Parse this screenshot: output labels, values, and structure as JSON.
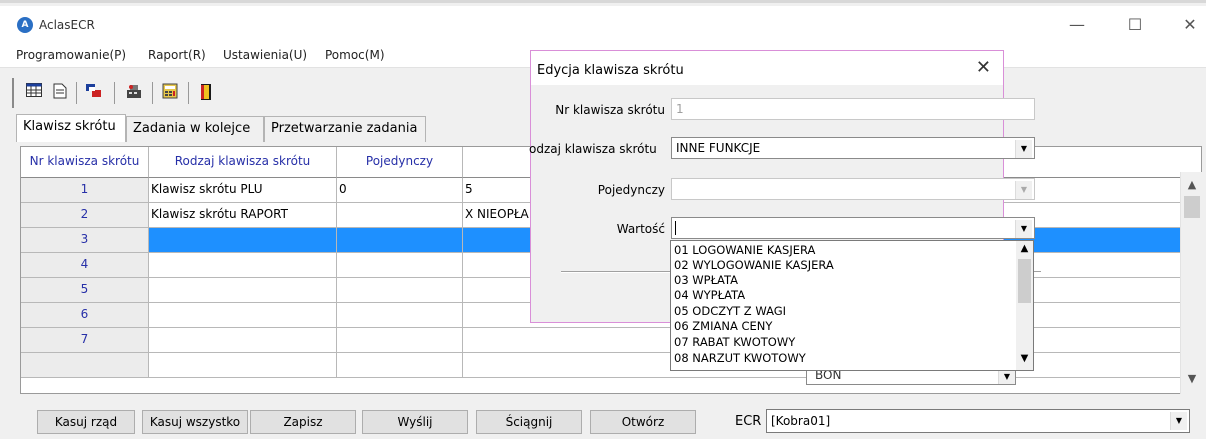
{
  "window": {
    "title": "AclasECR",
    "minimize": "—",
    "maximize": "☐",
    "close": "✕"
  },
  "menu": [
    "Programowanie(P)",
    "Raport(R)",
    "Ustawienia(U)",
    "Pomoc(M)"
  ],
  "toolbar": {
    "icons": [
      "table-icon",
      "document-icon",
      "transfer-icon",
      "cash-register-icon",
      "calculator-icon",
      "exit-door-icon"
    ]
  },
  "tabs": [
    "Klawisz skrótu",
    "Zadania w kolejce",
    "Przetwarzanie zadania"
  ],
  "grid": {
    "columns": [
      "Nr klawisza skrótu",
      "Rodzaj klawisza skrótu",
      "Pojedynczy",
      ""
    ],
    "rows": [
      {
        "nr": "1",
        "rodzaj": "Klawisz skrótu PLU",
        "pojedynczy": "0",
        "wartosc": "5"
      },
      {
        "nr": "2",
        "rodzaj": "Klawisz skrótu RAPORT",
        "pojedynczy": "",
        "wartosc": "X NIEOPŁA"
      },
      {
        "nr": "3",
        "rodzaj": "",
        "pojedynczy": "",
        "wartosc": ""
      },
      {
        "nr": "4",
        "rodzaj": "",
        "pojedynczy": "",
        "wartosc": ""
      },
      {
        "nr": "5",
        "rodzaj": "",
        "pojedynczy": "",
        "wartosc": ""
      },
      {
        "nr": "6",
        "rodzaj": "",
        "pojedynczy": "",
        "wartosc": ""
      },
      {
        "nr": "7",
        "rodzaj": "",
        "pojedynczy": "",
        "wartosc": ""
      }
    ],
    "selected_row": 3
  },
  "buttons": {
    "kasuj_rzad": "Kasuj rząd",
    "kasuj_wszystko": "Kasuj wszystko",
    "zapisz": "Zapisz",
    "wyslij": "Wyślij",
    "sciagnij": "Ściągnij",
    "otworz": "Otwórz"
  },
  "ecr": {
    "label": "ECR",
    "value": "[Kobra01]"
  },
  "partial_combo": "BON",
  "dialog": {
    "title": "Edycja klawisza skrótu",
    "close": "✕",
    "fields": {
      "nr_label": "Nr klawisza skrótu",
      "nr_value": "1",
      "rodzaj_label": "odzaj klawisza skrótu",
      "rodzaj_value": "INNE FUNKCJE",
      "pojedynczy_label": "Pojedynczy",
      "pojedynczy_value": "",
      "wartosc_label": "Wartość",
      "wartosc_value": ""
    },
    "dropdown_items": [
      "01 LOGOWANIE KASJERA",
      "02 WYLOGOWANIE KASJERA",
      "03 WPŁATA",
      "04 WYPŁATA",
      "05 ODCZYT Z WAGI",
      "06 ZMIANA CENY",
      "07 RABAT KWOTOWY",
      "08 NARZUT KWOTOWY"
    ]
  }
}
